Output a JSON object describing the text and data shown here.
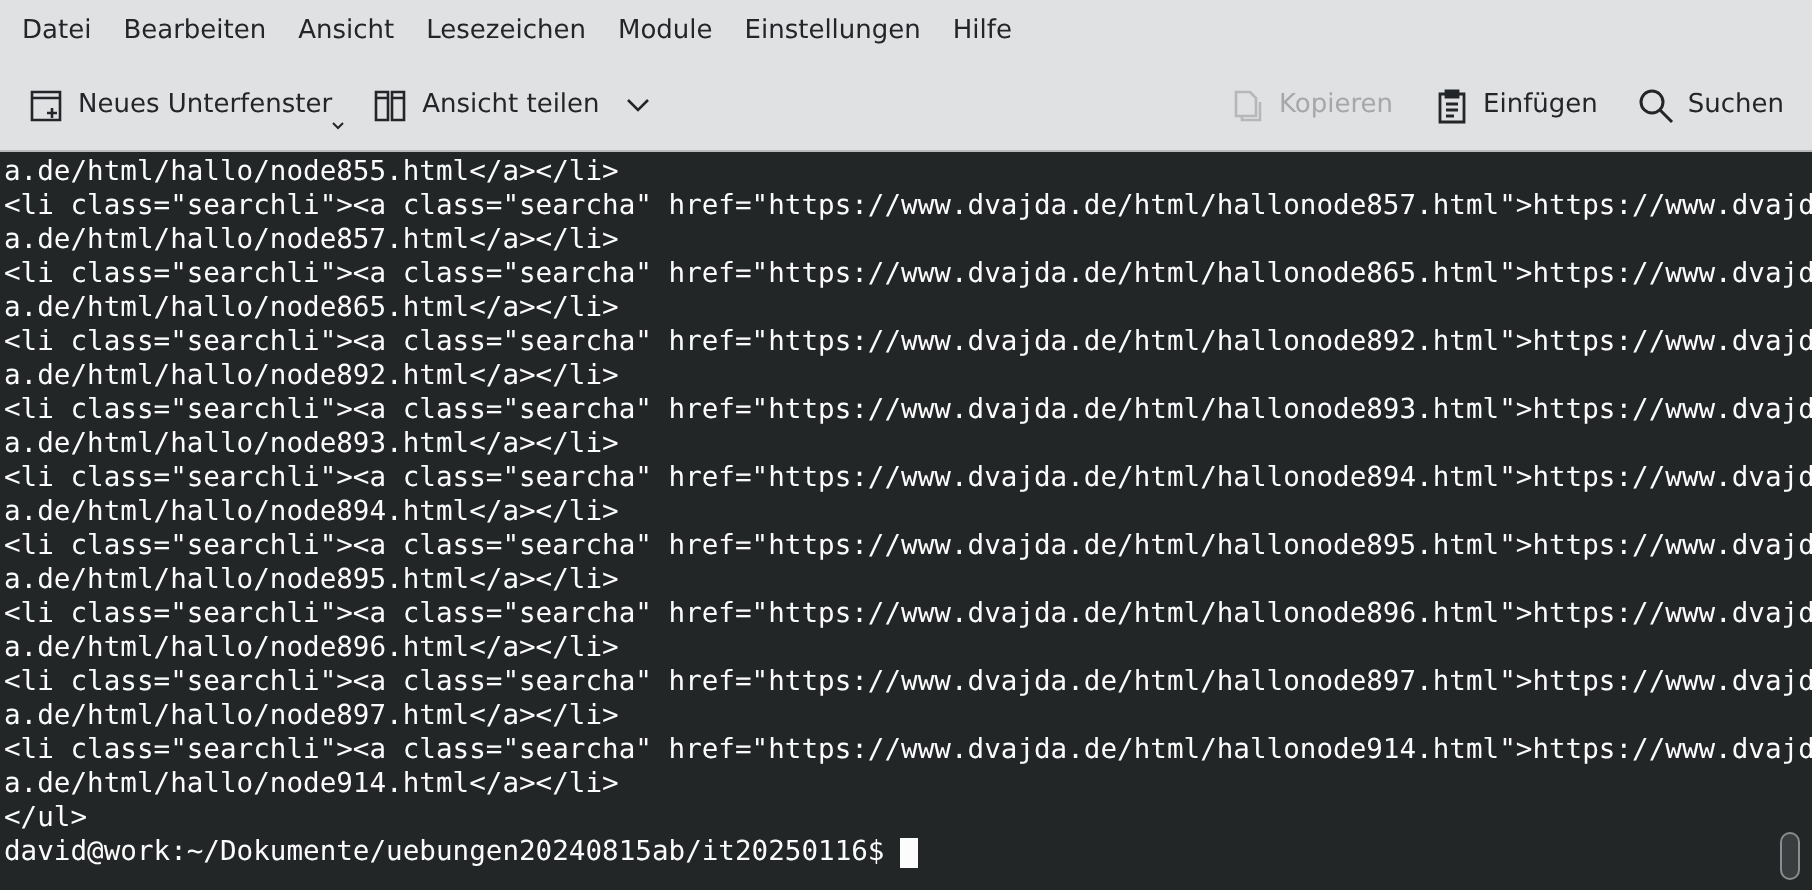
{
  "menu": [
    "Datei",
    "Bearbeiten",
    "Ansicht",
    "Lesezeichen",
    "Module",
    "Einstellungen",
    "Hilfe"
  ],
  "toolbar": {
    "left": [
      {
        "kind": "new-tab",
        "label": "Neues Unterfenster",
        "disabled": false
      },
      {
        "kind": "split",
        "label": "Ansicht teilen",
        "disabled": false
      }
    ],
    "right": [
      {
        "kind": "copy",
        "label": "Kopieren",
        "disabled": true
      },
      {
        "kind": "paste",
        "label": "Einfügen",
        "disabled": false
      },
      {
        "kind": "search",
        "label": "Suchen",
        "disabled": false
      }
    ]
  },
  "terminal": {
    "lines": [
      "a.de/html/hallo/node855.html</a></li>",
      "<li class=\"searchli\"><a class=\"searcha\" href=\"https://www.dvajda.de/html/hallonode857.html\">https://www.dvajd",
      "a.de/html/hallo/node857.html</a></li>",
      "<li class=\"searchli\"><a class=\"searcha\" href=\"https://www.dvajda.de/html/hallonode865.html\">https://www.dvajd",
      "a.de/html/hallo/node865.html</a></li>",
      "<li class=\"searchli\"><a class=\"searcha\" href=\"https://www.dvajda.de/html/hallonode892.html\">https://www.dvajd",
      "a.de/html/hallo/node892.html</a></li>",
      "<li class=\"searchli\"><a class=\"searcha\" href=\"https://www.dvajda.de/html/hallonode893.html\">https://www.dvajd",
      "a.de/html/hallo/node893.html</a></li>",
      "<li class=\"searchli\"><a class=\"searcha\" href=\"https://www.dvajda.de/html/hallonode894.html\">https://www.dvajd",
      "a.de/html/hallo/node894.html</a></li>",
      "<li class=\"searchli\"><a class=\"searcha\" href=\"https://www.dvajda.de/html/hallonode895.html\">https://www.dvajd",
      "a.de/html/hallo/node895.html</a></li>",
      "<li class=\"searchli\"><a class=\"searcha\" href=\"https://www.dvajda.de/html/hallonode896.html\">https://www.dvajd",
      "a.de/html/hallo/node896.html</a></li>",
      "<li class=\"searchli\"><a class=\"searcha\" href=\"https://www.dvajda.de/html/hallonode897.html\">https://www.dvajd",
      "a.de/html/hallo/node897.html</a></li>",
      "<li class=\"searchli\"><a class=\"searcha\" href=\"https://www.dvajda.de/html/hallonode914.html\">https://www.dvajd",
      "a.de/html/hallo/node914.html</a></li>",
      "</ul>"
    ],
    "prompt": "david@work:~/Dokumente/uebungen20240815ab/it20250116$"
  }
}
